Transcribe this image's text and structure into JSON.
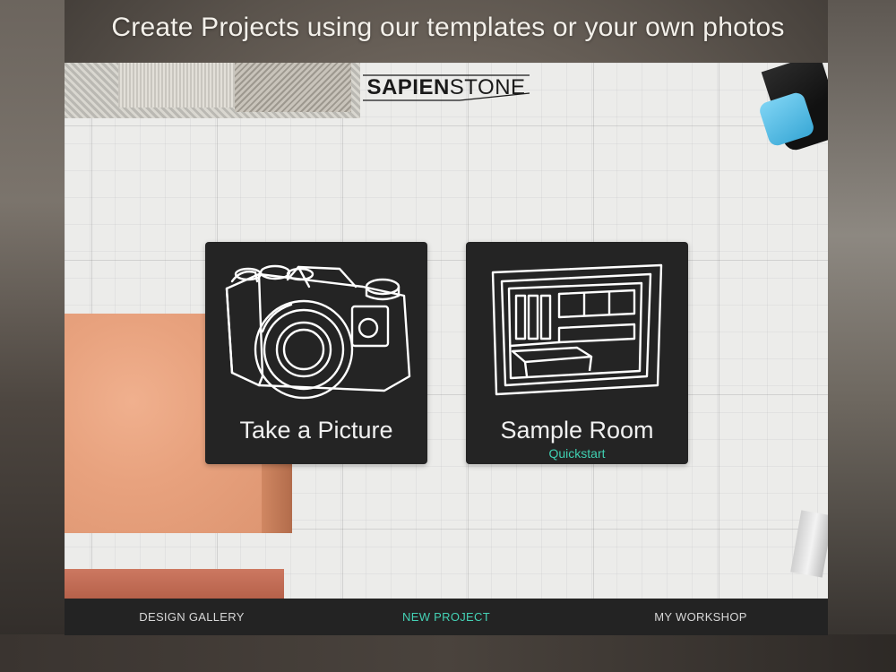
{
  "headline": "Create Projects using our templates or your own photos",
  "brand": {
    "part1": "SAPIEN",
    "part2": "STONE"
  },
  "cards": [
    {
      "title": "Take a Picture",
      "subtitle": "",
      "icon": "camera-icon"
    },
    {
      "title": "Sample Room",
      "subtitle": "Quickstart",
      "icon": "room-icon"
    }
  ],
  "tabs": [
    {
      "label": "DESIGN GALLERY",
      "active": false
    },
    {
      "label": "NEW PROJECT",
      "active": true
    },
    {
      "label": "MY WORKSHOP",
      "active": false
    }
  ],
  "colors": {
    "accent": "#44d2b5",
    "card_bg": "#242424",
    "tabbar_bg": "#232323"
  }
}
